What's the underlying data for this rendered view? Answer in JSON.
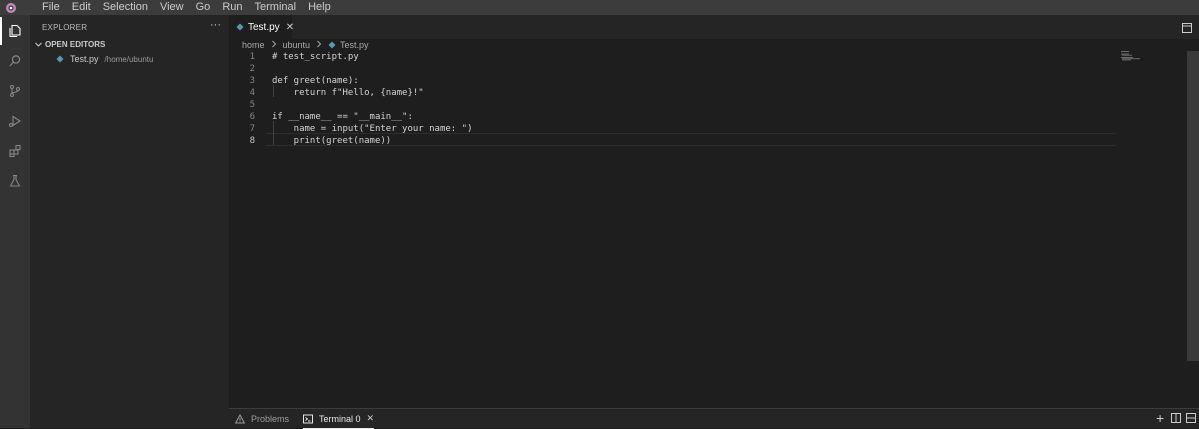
{
  "menu": [
    "File",
    "Edit",
    "Selection",
    "View",
    "Go",
    "Run",
    "Terminal",
    "Help"
  ],
  "sidebar": {
    "title": "EXPLORER",
    "more": "···",
    "section": "OPEN EDITORS",
    "files": [
      {
        "name": "Test.py",
        "path": "/home/ubuntu"
      }
    ]
  },
  "activity": {
    "icons": [
      "explorer-icon",
      "search-icon",
      "source-control-icon",
      "run-debug-icon",
      "extensions-icon",
      "testing-icon"
    ]
  },
  "tab": {
    "label": "Test.py",
    "close": "✕"
  },
  "breadcrumb": [
    "home",
    "ubuntu",
    "Test.py"
  ],
  "editor": {
    "active_line": 8,
    "lines": [
      {
        "n": "1",
        "text": "# test_script.py"
      },
      {
        "n": "2",
        "text": ""
      },
      {
        "n": "3",
        "text": "def greet(name):"
      },
      {
        "n": "4",
        "text": "    return f\"Hello, {name}!\""
      },
      {
        "n": "5",
        "text": ""
      },
      {
        "n": "6",
        "text": "if __name__ == \"__main__\":"
      },
      {
        "n": "7",
        "text": "    name = input(\"Enter your name: \")"
      },
      {
        "n": "8",
        "text": "    print(greet(name))"
      }
    ]
  },
  "panel": {
    "problems_label": "Problems",
    "terminal_label": "Terminal 0",
    "close": "✕",
    "add": "+"
  },
  "colors": {
    "background": "#1e1e1e",
    "sidebar": "#252526",
    "activitybar": "#333333",
    "menubar": "#3c3c3c",
    "python_icon": "#519aba"
  }
}
